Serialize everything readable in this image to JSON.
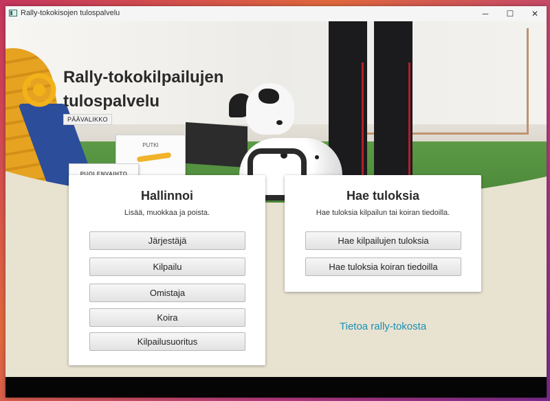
{
  "window": {
    "title": "Rally-tokokisojen tulospalvelu",
    "controls": {
      "minimize": "─",
      "maximize": "☐",
      "close": "✕"
    }
  },
  "hero": {
    "app_title": "Rally-tokokilpailujen tulospalvelu",
    "badge": "PÄÄVALIKKO",
    "signs": {
      "putki": "PUTKI",
      "puolenvaihto": "PUOLENVAIHTO"
    }
  },
  "admin": {
    "title": "Hallinnoi",
    "subtitle": "Lisää, muokkaa ja poista.",
    "buttons": [
      "Järjestäjä",
      "Kilpailu",
      "Omistaja",
      "Koira",
      "Kilpailusuoritus"
    ]
  },
  "search": {
    "title": "Hae tuloksia",
    "subtitle": "Hae tuloksia kilpailun tai koiran tiedoilla.",
    "buttons": [
      "Hae kilpailujen tuloksia",
      "Hae tuloksia koiran tiedoilla"
    ]
  },
  "about_link": "Tietoa rally-tokosta",
  "colors": {
    "accent_link": "#1a8fb4",
    "logo_yellow": "#f2b21a",
    "background": "#e8e2d0"
  }
}
